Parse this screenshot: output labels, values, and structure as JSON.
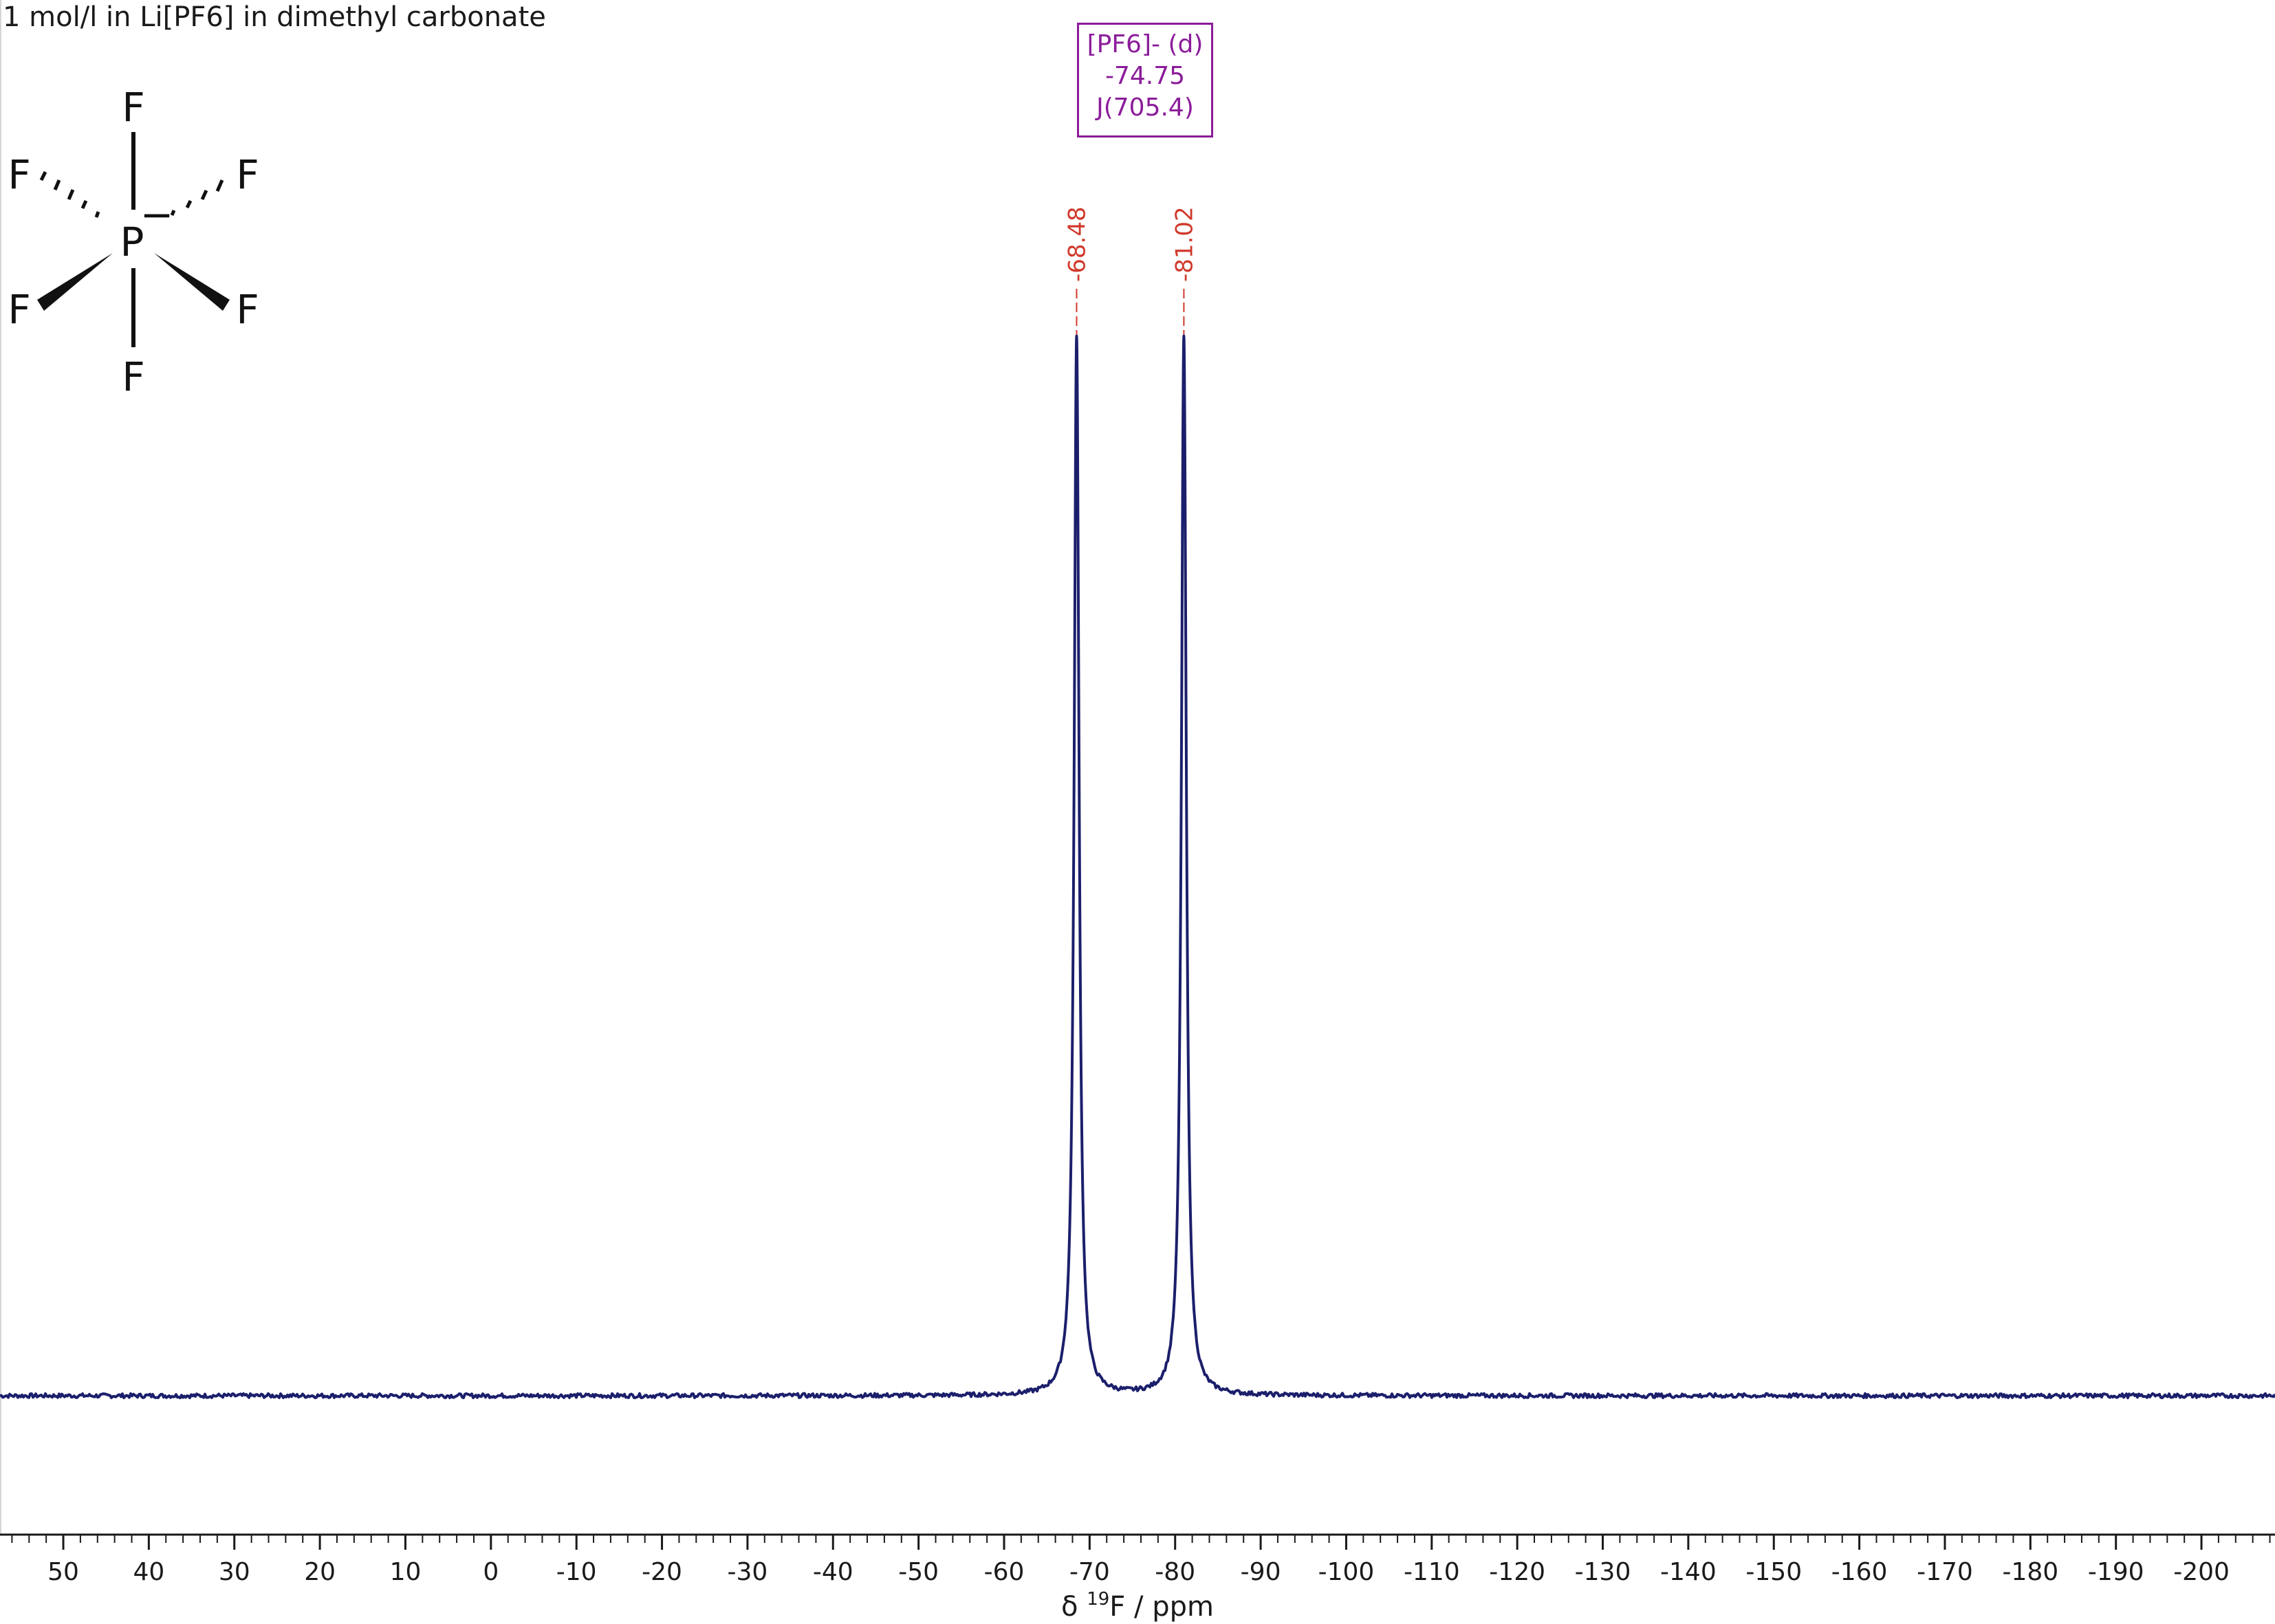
{
  "title": "1 mol/l in Li[PF6] in dimethyl carbonate",
  "annotation": {
    "lines": [
      "[PF6]- (d)",
      "-74.75",
      "J(705.4)"
    ],
    "color": "#8b1c9a"
  },
  "structure": {
    "atoms": {
      "center": "P",
      "charge": "−",
      "ligands": [
        "F",
        "F",
        "F",
        "F",
        "F",
        "F"
      ]
    }
  },
  "chart_data": {
    "type": "line",
    "title": "1 mol/l in Li[PF6] in dimethyl carbonate",
    "xlabel_prefix": "δ ",
    "xlabel_sup": "19",
    "xlabel_suffix": "F / ppm",
    "ylabel": "",
    "xlim": [
      57.4,
      -208.6
    ],
    "x_reversed": true,
    "ylim": [
      -0.13,
      1.15
    ],
    "ticks": [
      "50",
      "40",
      "30",
      "20",
      "10",
      "0",
      "-10",
      "-20",
      "-30",
      "-40",
      "-50",
      "-60",
      "-70",
      "-80",
      "-90",
      "-100",
      "-110",
      "-120",
      "-130",
      "-140",
      "-150",
      "-160",
      "-170",
      "-180",
      "-190",
      "-200"
    ],
    "tick_values": [
      50,
      40,
      30,
      20,
      10,
      0,
      -10,
      -20,
      -30,
      -40,
      -50,
      -60,
      -70,
      -80,
      -90,
      -100,
      -110,
      -120,
      -130,
      -140,
      -150,
      -160,
      -170,
      -180,
      -190,
      -200
    ],
    "minor_step": 2,
    "peak_labels": [
      "-68.48",
      "-81.02"
    ],
    "peaks": [
      {
        "x": -68.48,
        "height": 1.0,
        "width": 0.35
      },
      {
        "x": -81.02,
        "height": 1.0,
        "width": 0.35
      }
    ],
    "baseline": 0.0,
    "grid": false,
    "series": [
      {
        "color": "#1b1f6b"
      }
    ],
    "peak_label_color": "#d0392b"
  }
}
